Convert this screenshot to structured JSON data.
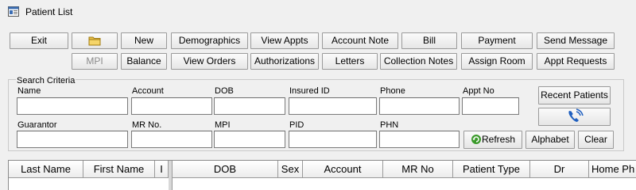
{
  "window": {
    "title": "Patient List"
  },
  "toolbar": {
    "row1": [
      "Exit",
      "",
      "New",
      "Demographics",
      "View Appts",
      "Account Note",
      "Bill",
      "Payment",
      "Send Message"
    ],
    "row2": [
      "MPI",
      "Balance",
      "View Orders",
      "Authorizations",
      "Letters",
      "Collection Notes",
      "Assign Room",
      "Appt Requests"
    ]
  },
  "search": {
    "group_title": "Search Criteria",
    "labels": {
      "name": "Name",
      "account": "Account",
      "dob": "DOB",
      "insured_id": "Insured ID",
      "phone": "Phone",
      "appt_no": "Appt No",
      "guarantor": "Guarantor",
      "mr_no": "MR No.",
      "mpi": "MPI",
      "pid": "PID",
      "phn": "PHN"
    },
    "values": {
      "name": "",
      "account": "",
      "dob": "",
      "insured_id": "",
      "phone": "",
      "appt_no": "",
      "guarantor": "",
      "mr_no": "",
      "mpi": "",
      "pid": "",
      "phn": ""
    },
    "buttons": {
      "recent_patients": "Recent Patients",
      "refresh": "Refresh",
      "alphabet": "Alphabet",
      "clear": "Clear"
    }
  },
  "grid": {
    "columns": [
      "Last Name",
      "First Name",
      "I",
      "DOB",
      "Sex",
      "Account",
      "MR No",
      "Patient Type",
      "Dr",
      "Home Ph"
    ]
  },
  "icons": {
    "folder": "folder-icon",
    "phone": "phone-icon",
    "refresh": "refresh-icon",
    "app": "window-icon"
  },
  "colors": {
    "phone_icon": "#1f5fbf",
    "refresh_icon": "#3a9a2a"
  }
}
